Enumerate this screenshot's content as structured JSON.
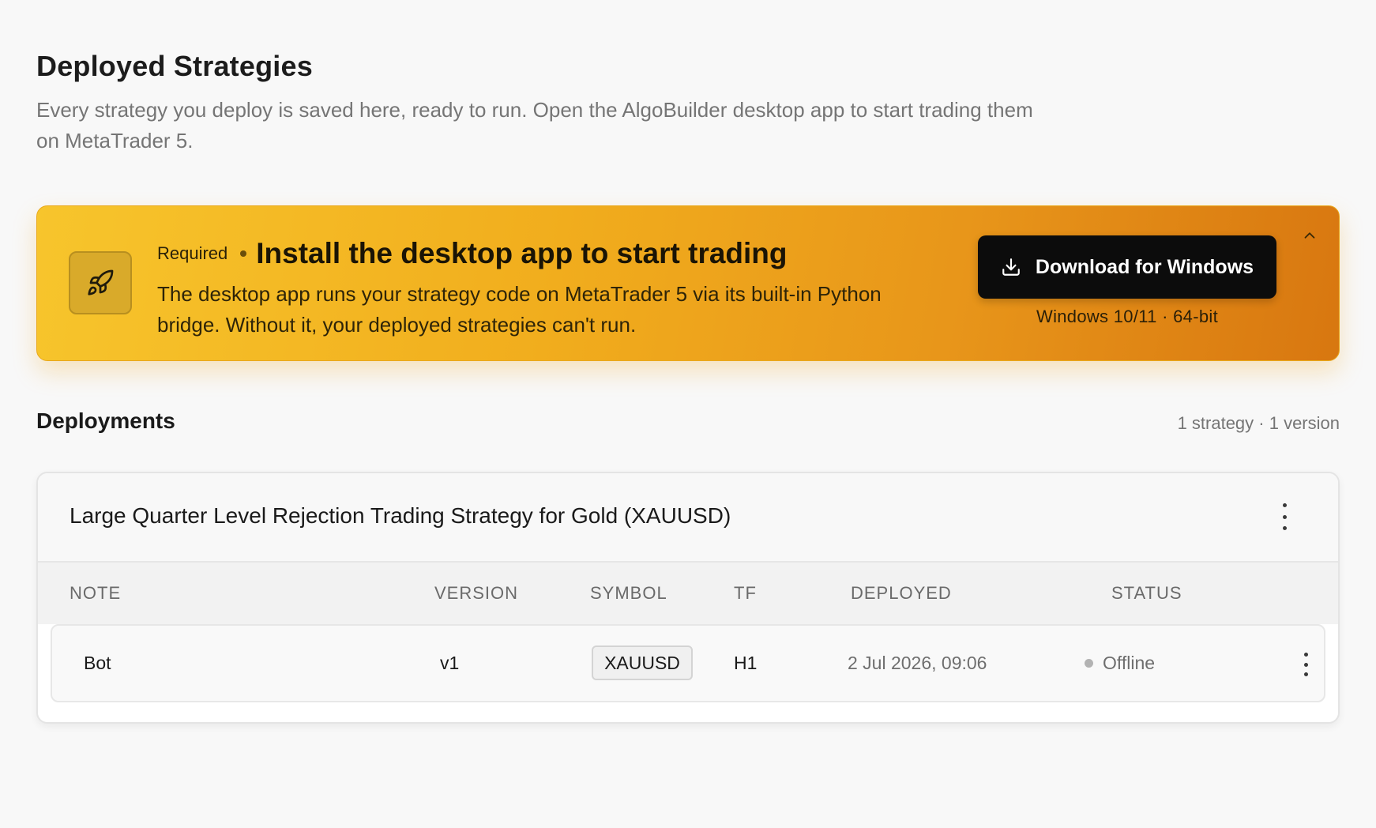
{
  "page": {
    "title": "Deployed Strategies",
    "subtitle": "Every strategy you deploy is saved here, ready to run. Open the AlgoBuilder desktop app to start trading them on MetaTrader 5."
  },
  "banner": {
    "icon": "rocket-icon",
    "required_label": "Required",
    "title": "Install the desktop app to start trading",
    "description": "The desktop app runs your strategy code on MetaTrader 5 via its built-in Python bridge. Without it, your deployed strategies can't run.",
    "download_label": "Download for Windows",
    "download_icon": "download-icon",
    "download_sub": "Windows 10/11 · 64-bit",
    "collapse_icon": "chevron-up-icon",
    "colors": {
      "gradient_start": "#f7c52c",
      "gradient_end": "#d87710",
      "button": "#0c0c0c"
    }
  },
  "deployments": {
    "title": "Deployments",
    "count": "1 strategy · 1 version",
    "strategy": {
      "name": "Large Quarter Level Rejection Trading Strategy for Gold (XAUUSD)",
      "columns": [
        "NOTE",
        "VERSION",
        "SYMBOL",
        "TF",
        "DEPLOYED",
        "STATUS"
      ],
      "rows": [
        {
          "note": "Bot",
          "version": "v1",
          "symbol": "XAUUSD",
          "tf": "H1",
          "deployed": "2 Jul 2026, 09:06",
          "status": "Offline",
          "status_color": "#b3b3b3"
        }
      ]
    }
  }
}
